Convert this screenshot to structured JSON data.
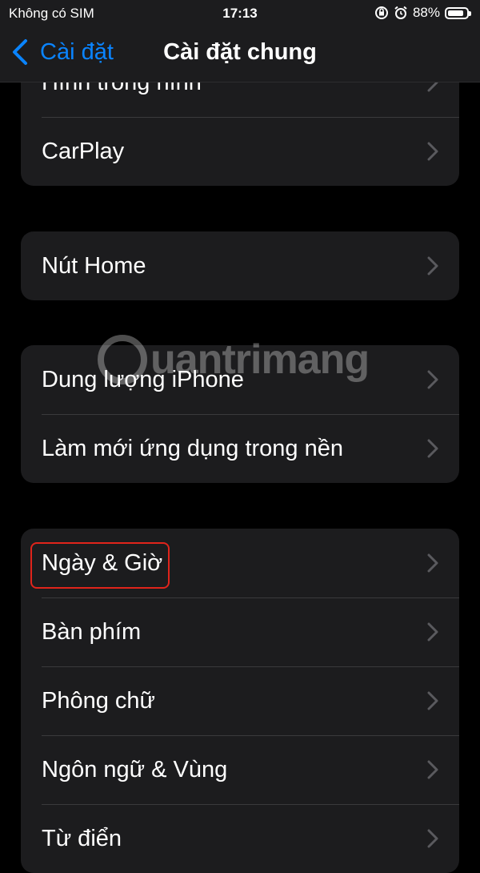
{
  "status_bar": {
    "carrier": "Không có SIM",
    "time": "17:13",
    "battery_percent": "88%",
    "battery_level": 0.88,
    "icons": [
      "orientation-lock-icon",
      "alarm-icon",
      "battery-icon"
    ]
  },
  "nav": {
    "back_label": "Cài đặt",
    "title": "Cài đặt chung"
  },
  "groups": [
    {
      "rows": [
        {
          "label": "Hình trong hình"
        },
        {
          "label": "CarPlay"
        }
      ]
    },
    {
      "rows": [
        {
          "label": "Nút Home"
        }
      ]
    },
    {
      "rows": [
        {
          "label": "Dung lượng iPhone"
        },
        {
          "label": "Làm mới ứng dụng trong nền"
        }
      ]
    },
    {
      "rows": [
        {
          "label": "Ngày & Giờ"
        },
        {
          "label": "Bàn phím"
        },
        {
          "label": "Phông chữ"
        },
        {
          "label": "Ngôn ngữ & Vùng"
        },
        {
          "label": "Từ điển"
        }
      ]
    }
  ],
  "highlighted_row": "Ngày & Giờ",
  "watermark": {
    "text": "uantrimang"
  },
  "colors": {
    "accent": "#0a84ff",
    "highlight": "#e0241b",
    "cell_bg": "#1c1c1e"
  }
}
